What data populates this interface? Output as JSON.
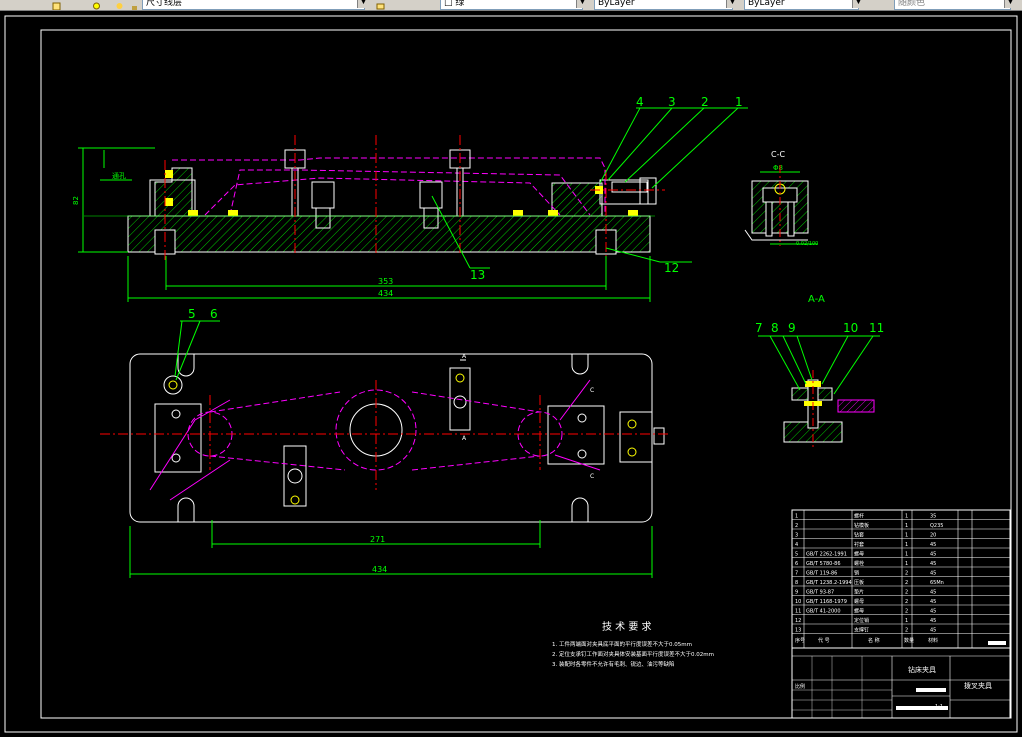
{
  "toolbar": {
    "layer_label": "尺寸线层",
    "color_label": "□ 绿",
    "linetype_label": "ByLayer",
    "lineweight_label": "ByLayer",
    "plotstyle_label": "随颜色"
  },
  "drawing": {
    "front_view": {
      "height_dim": "82",
      "left_note": "通孔",
      "dim_inner": "353",
      "dim_outer": "434",
      "balloons": [
        "4",
        "3",
        "2",
        "1",
        "13",
        "12"
      ]
    },
    "section_cc": {
      "title": "C-C",
      "dim": "Φ8",
      "note": "0.02/100"
    },
    "section_aa": {
      "title": "A-A",
      "balloons": [
        "7",
        "8",
        "9",
        "10",
        "11"
      ]
    },
    "plan_view": {
      "balloons": [
        "5",
        "6"
      ],
      "dim_inner": "271",
      "dim_outer": "434",
      "section_marks": [
        "A",
        "A",
        "C",
        "C"
      ]
    },
    "tech_req": {
      "title": "技 术 要 求",
      "items": [
        "1. 工件两端面对夹具底平面的平行度误差不大于0.05mm",
        "2. 定位支承钉工作面对夹具体安装基面平行度误差不大于0.02mm",
        "3. 装配时各零件不允许有毛刺、锐边、油污等缺陷"
      ]
    },
    "bom": {
      "rows": [
        {
          "no": "1",
          "code": "",
          "name": "螺杆",
          "qty": "1",
          "mat": "35"
        },
        {
          "no": "2",
          "code": "",
          "name": "钻模板",
          "qty": "1",
          "mat": "Q235"
        },
        {
          "no": "3",
          "code": "",
          "name": "钻套",
          "qty": "1",
          "mat": "20"
        },
        {
          "no": "4",
          "code": "",
          "name": "衬套",
          "qty": "1",
          "mat": "45"
        },
        {
          "no": "5",
          "code": "GB/T 2262-1991",
          "name": "螺母",
          "qty": "1",
          "mat": "45"
        },
        {
          "no": "6",
          "code": "GB/T 5780-86",
          "name": "螺栓",
          "qty": "1",
          "mat": "45"
        },
        {
          "no": "7",
          "code": "GB/T 119-86",
          "name": "销",
          "qty": "2",
          "mat": "45"
        },
        {
          "no": "8",
          "code": "GB/T 1238.2-1994",
          "name": "压板",
          "qty": "2",
          "mat": "65Mn"
        },
        {
          "no": "9",
          "code": "GB/T 93-87",
          "name": "垫片",
          "qty": "2",
          "mat": "45"
        },
        {
          "no": "10",
          "code": "GB/T 1168-1979",
          "name": "螺母",
          "qty": "2",
          "mat": "45"
        },
        {
          "no": "11",
          "code": "GB/T 41-2000",
          "name": "螺母",
          "qty": "2",
          "mat": "45"
        },
        {
          "no": "12",
          "code": "",
          "name": "定位销",
          "qty": "1",
          "mat": "45"
        },
        {
          "no": "13",
          "code": "",
          "name": "支撑钉",
          "qty": "2",
          "mat": "45"
        }
      ],
      "header": {
        "no": "序号",
        "code": "代 号",
        "name": "名 称",
        "qty": "数量",
        "mat": "材料"
      },
      "title_block_name": "钻床夹具",
      "title_block_drawing": "拨叉夹具",
      "scale_label": "比例",
      "scale_value": "1:1"
    }
  },
  "colors": {
    "part": "#ffffff",
    "dim": "#00ff00",
    "center": "#ff0000",
    "hidden": "#ff00ff",
    "hatch": "#00ff00",
    "accent": "#ffff00",
    "frame": "#ffffff"
  }
}
